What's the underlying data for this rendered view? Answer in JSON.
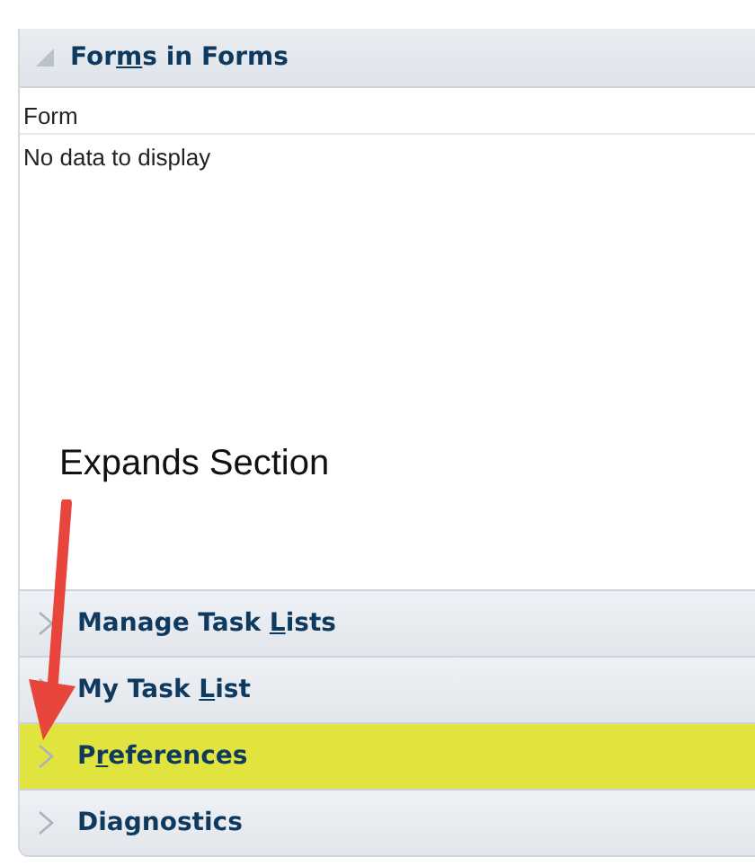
{
  "expanded_section": {
    "title": {
      "before": "For",
      "key": "m",
      "after": "s in Forms"
    },
    "expanded": true,
    "columns": [
      "Form"
    ],
    "empty_message": "No data to display"
  },
  "annotation": {
    "text": "Expands Section"
  },
  "sections": [
    {
      "title": {
        "before": "Manage Task ",
        "key": "L",
        "after": "ists"
      },
      "expanded": false,
      "highlighted": false
    },
    {
      "title": {
        "before": "My Task ",
        "key": "L",
        "after": "ist"
      },
      "expanded": false,
      "highlighted": false
    },
    {
      "title": {
        "before": "P",
        "key": "r",
        "after": "eferences"
      },
      "expanded": false,
      "highlighted": true
    },
    {
      "title": {
        "before": "Diagnostics"
      },
      "expanded": false,
      "highlighted": false
    }
  ]
}
